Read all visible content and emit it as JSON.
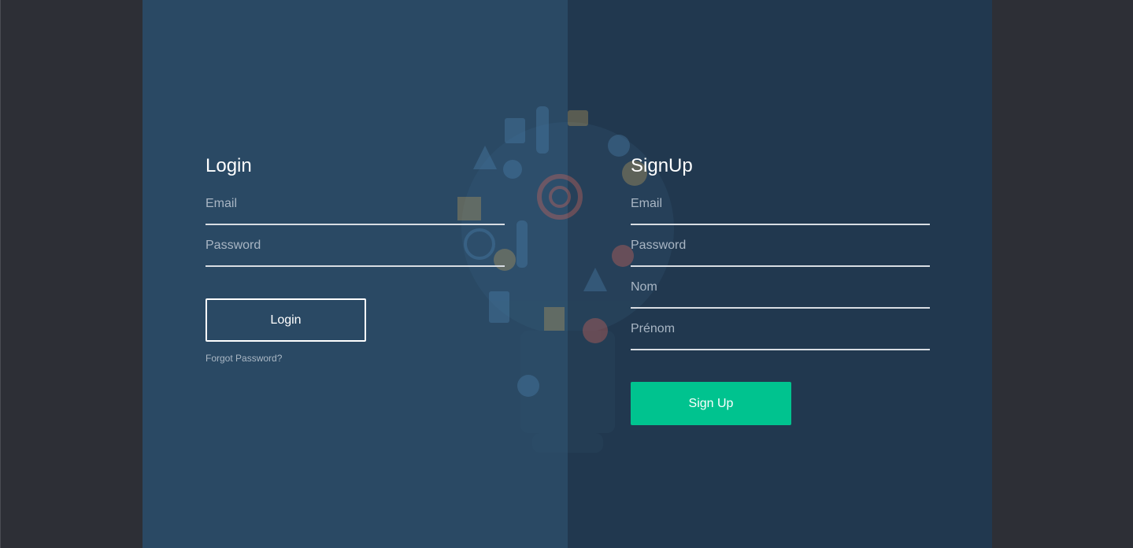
{
  "login": {
    "title": "Login",
    "email_placeholder": "Email",
    "password_placeholder": "Password",
    "button_label": "Login",
    "forgot_label": "Forgot Password?"
  },
  "signup": {
    "title": "SignUp",
    "email_placeholder": "Email",
    "password_placeholder": "Password",
    "nom_placeholder": "Nom",
    "prenom_placeholder": "Prénom",
    "button_label": "Sign Up"
  },
  "colors": {
    "outer_bg": "#2d2f36",
    "left_panel": "#2a4964",
    "right_panel": "#21384f",
    "accent_green": "#00c38f"
  }
}
